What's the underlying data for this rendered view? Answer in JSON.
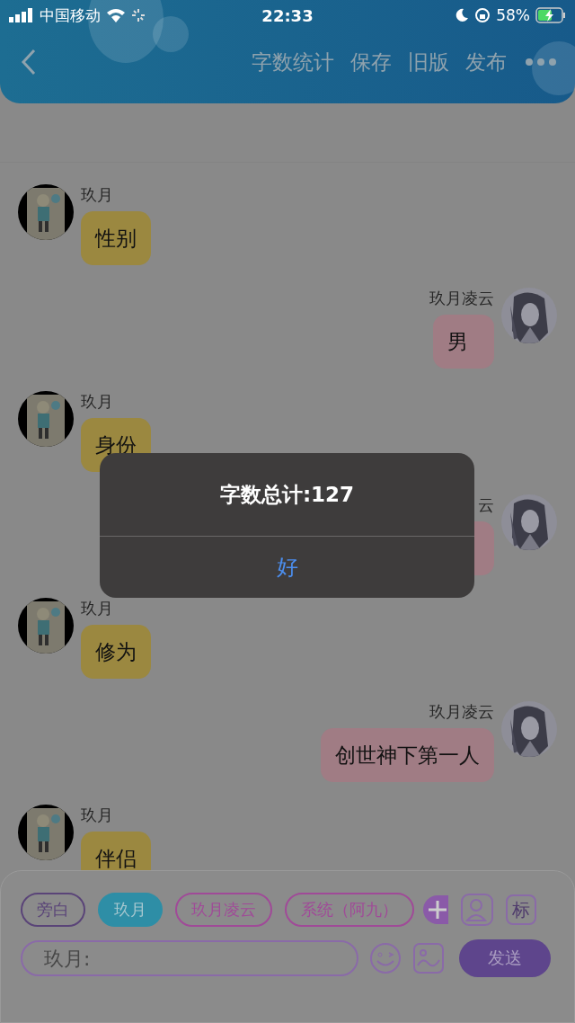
{
  "status_bar": {
    "carrier": "中国移动",
    "time": "22:33",
    "battery": "58%"
  },
  "header": {
    "actions": [
      "字数统计",
      "保存",
      "旧版",
      "发布"
    ]
  },
  "messages": [
    {
      "kind": "received",
      "name": "玖月",
      "text": "性别"
    },
    {
      "kind": "sent",
      "name": "玖月凌云",
      "text": "男"
    },
    {
      "kind": "received",
      "name": "玖月",
      "text": "身份"
    },
    {
      "kind": "sent",
      "name": "云"
    },
    {
      "kind": "received",
      "name": "玖月",
      "text": "修为"
    },
    {
      "kind": "sent",
      "name": "玖月凌云",
      "text": "创世神下第一人"
    },
    {
      "kind": "received",
      "name": "玖月",
      "text": "伴侣"
    }
  ],
  "roles": [
    {
      "label": "旁白",
      "selected": false,
      "color": "#5a4478"
    },
    {
      "label": "玖月",
      "selected": true,
      "color": "#2e8ea6"
    },
    {
      "label": "玖月凌云",
      "selected": false,
      "color": "#a04a98"
    },
    {
      "label": "系统（阿九）",
      "selected": false,
      "color": "#a04a98"
    }
  ],
  "tag_button": "标",
  "input": {
    "placeholder": "玖月:"
  },
  "send_button": "发送",
  "dialog": {
    "title": "字数总计:127",
    "button": "好"
  }
}
